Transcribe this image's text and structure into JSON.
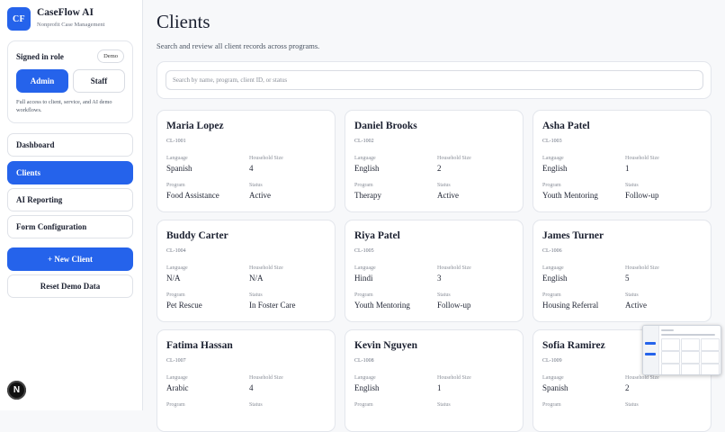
{
  "brand": {
    "logo": "CF",
    "title": "CaseFlow AI",
    "subtitle": "Nonprofit Case Management"
  },
  "role": {
    "label": "Signed in role",
    "badge": "Demo",
    "admin": "Admin",
    "staff": "Staff",
    "selected": "Admin",
    "description": "Full access to client, service, and AI demo workflows."
  },
  "nav": {
    "items": [
      {
        "label": "Dashboard",
        "active": false
      },
      {
        "label": "Clients",
        "active": true
      },
      {
        "label": "AI Reporting",
        "active": false
      },
      {
        "label": "Form Configuration",
        "active": false
      }
    ]
  },
  "actions": {
    "new_client": "+ New Client",
    "reset": "Reset Demo Data"
  },
  "avatar": {
    "letter": "N"
  },
  "page": {
    "title": "Clients",
    "subtitle": "Search and review all client records across programs."
  },
  "search": {
    "placeholder": "Search by name, program, client ID, or status",
    "value": ""
  },
  "field_labels": {
    "language": "Language",
    "household": "Household Size",
    "program": "Program",
    "status": "Status"
  },
  "clients": [
    {
      "name": "Maria Lopez",
      "id": "CL-1001",
      "language": "Spanish",
      "household": "4",
      "program": "Food Assistance",
      "status": "Active"
    },
    {
      "name": "Daniel Brooks",
      "id": "CL-1002",
      "language": "English",
      "household": "2",
      "program": "Therapy",
      "status": "Active"
    },
    {
      "name": "Asha Patel",
      "id": "CL-1003",
      "language": "English",
      "household": "1",
      "program": "Youth Mentoring",
      "status": "Follow-up"
    },
    {
      "name": "Buddy Carter",
      "id": "CL-1004",
      "language": "N/A",
      "household": "N/A",
      "program": "Pet Rescue",
      "status": "In Foster Care"
    },
    {
      "name": "Riya Patel",
      "id": "CL-1005",
      "language": "Hindi",
      "household": "3",
      "program": "Youth Mentoring",
      "status": "Follow-up"
    },
    {
      "name": "James Turner",
      "id": "CL-1006",
      "language": "English",
      "household": "5",
      "program": "Housing Referral",
      "status": "Active"
    },
    {
      "name": "Fatima Hassan",
      "id": "CL-1007",
      "language": "Arabic",
      "household": "4",
      "program": "",
      "status": ""
    },
    {
      "name": "Kevin Nguyen",
      "id": "CL-1008",
      "language": "English",
      "household": "1",
      "program": "",
      "status": ""
    },
    {
      "name": "Sofia Ramirez",
      "id": "CL-1009",
      "language": "Spanish",
      "household": "2",
      "program": "",
      "status": ""
    }
  ],
  "colors": {
    "accent": "#2563eb",
    "background": "#f7f8fa",
    "card": "#ffffff",
    "border": "#e3e6ec"
  }
}
